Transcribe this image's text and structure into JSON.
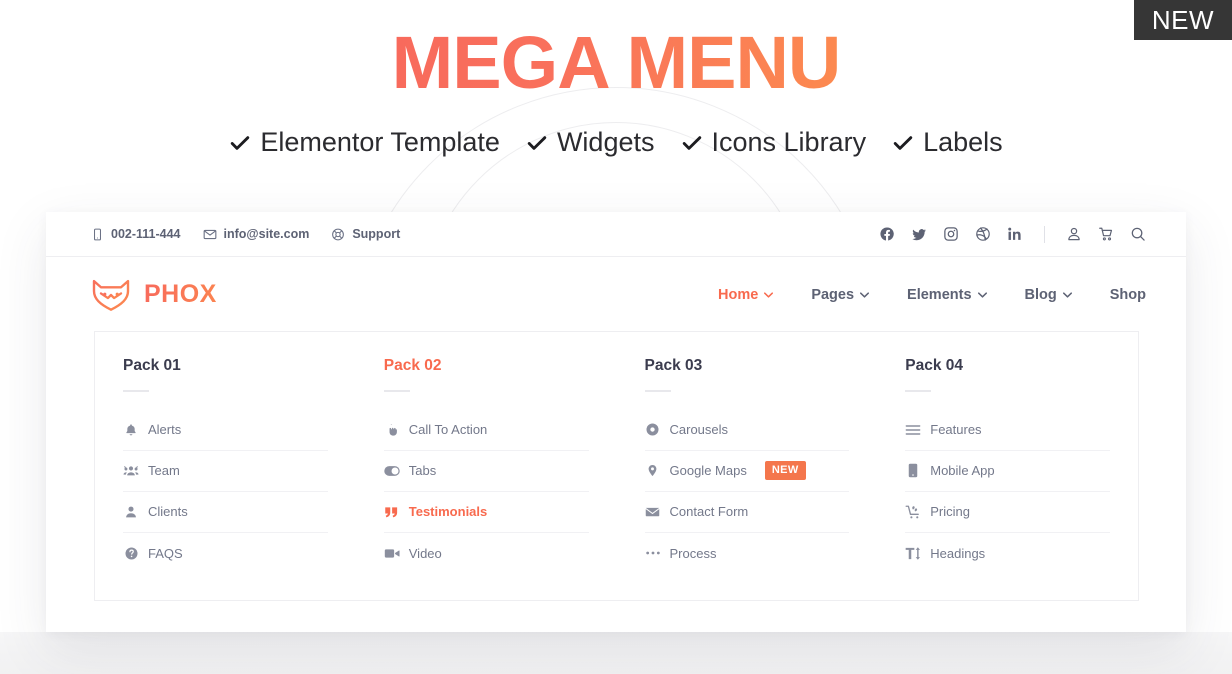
{
  "corner_badge": {
    "label": "NEW"
  },
  "hero": {
    "title": "MEGA MENU",
    "features": [
      {
        "icon": "check-icon",
        "label": "Elementor Template"
      },
      {
        "icon": "check-icon",
        "label": "Widgets"
      },
      {
        "icon": "check-icon",
        "label": "Icons Library"
      },
      {
        "icon": "check-icon",
        "label": "Labels"
      }
    ]
  },
  "site": {
    "topbar": {
      "contacts": [
        {
          "icon": "mobile-icon",
          "label": "002-111-444"
        },
        {
          "icon": "envelope-icon",
          "label": "info@site.com"
        },
        {
          "icon": "lifering-icon",
          "label": "Support"
        }
      ],
      "social": [
        {
          "icon": "facebook-icon",
          "label": "Facebook"
        },
        {
          "icon": "twitter-icon",
          "label": "Twitter"
        },
        {
          "icon": "instagram-icon",
          "label": "Instagram"
        },
        {
          "icon": "dribbble-icon",
          "label": "Dribbble"
        },
        {
          "icon": "linkedin-icon",
          "label": "LinkedIn"
        }
      ],
      "actions": [
        {
          "icon": "user-icon",
          "label": "Account"
        },
        {
          "icon": "cart-icon",
          "label": "Cart"
        },
        {
          "icon": "search-icon",
          "label": "Search"
        }
      ]
    },
    "brand": {
      "name": "PHOX",
      "logo_icon": "fox-logo-icon"
    },
    "nav": [
      {
        "label": "Home",
        "has_caret": true,
        "active": true
      },
      {
        "label": "Pages",
        "has_caret": true,
        "active": false
      },
      {
        "label": "Elements",
        "has_caret": true,
        "active": false
      },
      {
        "label": "Blog",
        "has_caret": true,
        "active": false
      },
      {
        "label": "Shop",
        "has_caret": false,
        "active": false
      }
    ],
    "mega_menu": {
      "columns": [
        {
          "title": "Pack 01",
          "accent": false,
          "items": [
            {
              "icon": "bell-icon",
              "label": "Alerts",
              "accent": false,
              "badge": null
            },
            {
              "icon": "users-icon",
              "label": "Team",
              "accent": false,
              "badge": null
            },
            {
              "icon": "user-icon",
              "label": "Clients",
              "accent": false,
              "badge": null
            },
            {
              "icon": "question-circle-icon",
              "label": "FAQS",
              "accent": false,
              "badge": null
            }
          ]
        },
        {
          "title": "Pack 02",
          "accent": true,
          "items": [
            {
              "icon": "hand-pointer-icon",
              "label": "Call To Action",
              "accent": false,
              "badge": null
            },
            {
              "icon": "toggle-on-icon",
              "label": "Tabs",
              "accent": false,
              "badge": null
            },
            {
              "icon": "quote-left-icon",
              "label": "Testimonials",
              "accent": true,
              "badge": null
            },
            {
              "icon": "video-icon",
              "label": "Video",
              "accent": false,
              "badge": null
            }
          ]
        },
        {
          "title": "Pack 03",
          "accent": false,
          "items": [
            {
              "icon": "dot-circle-icon",
              "label": "Carousels",
              "accent": false,
              "badge": null
            },
            {
              "icon": "map-marker-icon",
              "label": "Google Maps",
              "accent": false,
              "badge": "NEW"
            },
            {
              "icon": "envelope-icon",
              "label": "Contact Form",
              "accent": false,
              "badge": null
            },
            {
              "icon": "ellipsis-icon",
              "label": "Process",
              "accent": false,
              "badge": null
            }
          ]
        },
        {
          "title": "Pack 04",
          "accent": false,
          "items": [
            {
              "icon": "bars-icon",
              "label": "Features",
              "accent": false,
              "badge": null
            },
            {
              "icon": "mobile-icon",
              "label": "Mobile App",
              "accent": false,
              "badge": null
            },
            {
              "icon": "cart-flatbed-icon",
              "label": "Pricing",
              "accent": false,
              "badge": null
            },
            {
              "icon": "text-height-icon",
              "label": "Headings",
              "accent": false,
              "badge": null
            }
          ]
        }
      ]
    }
  },
  "colors": {
    "accent": "#f86a4e",
    "accent_gradient_start": "#f86a5c",
    "accent_gradient_end": "#fc8a4f",
    "badge_new_bg": "#f4764c",
    "corner_badge_bg": "#363636",
    "text_dark": "#3b3c4e",
    "text_muted": "#73788a"
  }
}
